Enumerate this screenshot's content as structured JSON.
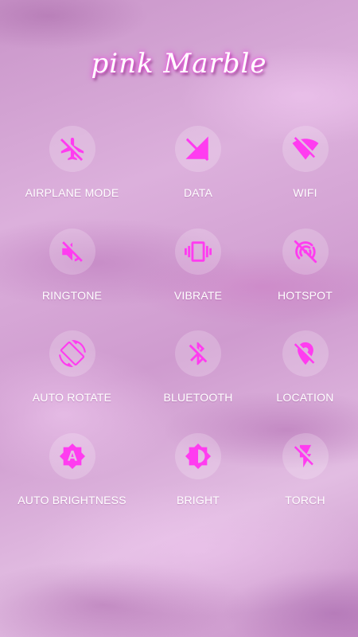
{
  "app": {
    "title": "pink Marble"
  },
  "colors": {
    "icon_accent": "#ff3cf0",
    "label_text": "#ffffff",
    "circle_fill": "rgba(255,255,255,0.20)"
  },
  "toggles": [
    {
      "label": "AIRPLANE MODE",
      "icon": "airplane-off-icon"
    },
    {
      "label": "DATA",
      "icon": "mobile-data-off-icon"
    },
    {
      "label": "WIFI",
      "icon": "wifi-off-icon"
    },
    {
      "label": "RINGTONE",
      "icon": "volume-off-icon"
    },
    {
      "label": "VIBRATE",
      "icon": "vibrate-icon"
    },
    {
      "label": "HOTSPOT",
      "icon": "hotspot-off-icon"
    },
    {
      "label": "AUTO ROTATE",
      "icon": "screen-rotation-icon"
    },
    {
      "label": "BLUETOOTH",
      "icon": "bluetooth-off-icon"
    },
    {
      "label": "LOCATION",
      "icon": "location-off-icon"
    },
    {
      "label": "AUTO BRIGHTNESS",
      "icon": "brightness-auto-icon"
    },
    {
      "label": "BRIGHT",
      "icon": "brightness-medium-icon"
    },
    {
      "label": "TORCH",
      "icon": "flashlight-off-icon"
    }
  ]
}
